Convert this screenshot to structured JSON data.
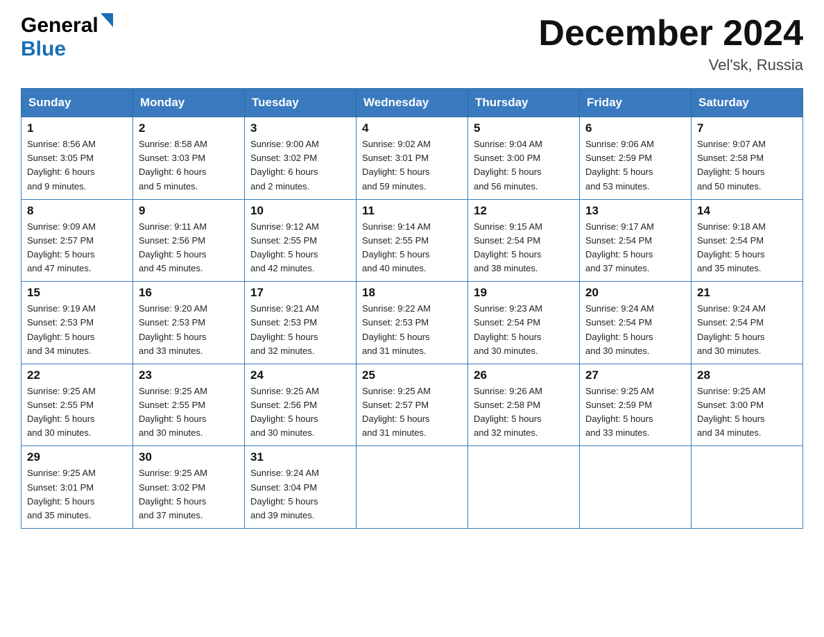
{
  "header": {
    "logo_general": "General",
    "logo_blue": "Blue",
    "month_title": "December 2024",
    "location": "Vel'sk, Russia"
  },
  "weekdays": [
    "Sunday",
    "Monday",
    "Tuesday",
    "Wednesday",
    "Thursday",
    "Friday",
    "Saturday"
  ],
  "weeks": [
    [
      {
        "day": "1",
        "sunrise": "8:56 AM",
        "sunset": "3:05 PM",
        "daylight": "6 hours and 9 minutes."
      },
      {
        "day": "2",
        "sunrise": "8:58 AM",
        "sunset": "3:03 PM",
        "daylight": "6 hours and 5 minutes."
      },
      {
        "day": "3",
        "sunrise": "9:00 AM",
        "sunset": "3:02 PM",
        "daylight": "6 hours and 2 minutes."
      },
      {
        "day": "4",
        "sunrise": "9:02 AM",
        "sunset": "3:01 PM",
        "daylight": "5 hours and 59 minutes."
      },
      {
        "day": "5",
        "sunrise": "9:04 AM",
        "sunset": "3:00 PM",
        "daylight": "5 hours and 56 minutes."
      },
      {
        "day": "6",
        "sunrise": "9:06 AM",
        "sunset": "2:59 PM",
        "daylight": "5 hours and 53 minutes."
      },
      {
        "day": "7",
        "sunrise": "9:07 AM",
        "sunset": "2:58 PM",
        "daylight": "5 hours and 50 minutes."
      }
    ],
    [
      {
        "day": "8",
        "sunrise": "9:09 AM",
        "sunset": "2:57 PM",
        "daylight": "5 hours and 47 minutes."
      },
      {
        "day": "9",
        "sunrise": "9:11 AM",
        "sunset": "2:56 PM",
        "daylight": "5 hours and 45 minutes."
      },
      {
        "day": "10",
        "sunrise": "9:12 AM",
        "sunset": "2:55 PM",
        "daylight": "5 hours and 42 minutes."
      },
      {
        "day": "11",
        "sunrise": "9:14 AM",
        "sunset": "2:55 PM",
        "daylight": "5 hours and 40 minutes."
      },
      {
        "day": "12",
        "sunrise": "9:15 AM",
        "sunset": "2:54 PM",
        "daylight": "5 hours and 38 minutes."
      },
      {
        "day": "13",
        "sunrise": "9:17 AM",
        "sunset": "2:54 PM",
        "daylight": "5 hours and 37 minutes."
      },
      {
        "day": "14",
        "sunrise": "9:18 AM",
        "sunset": "2:54 PM",
        "daylight": "5 hours and 35 minutes."
      }
    ],
    [
      {
        "day": "15",
        "sunrise": "9:19 AM",
        "sunset": "2:53 PM",
        "daylight": "5 hours and 34 minutes."
      },
      {
        "day": "16",
        "sunrise": "9:20 AM",
        "sunset": "2:53 PM",
        "daylight": "5 hours and 33 minutes."
      },
      {
        "day": "17",
        "sunrise": "9:21 AM",
        "sunset": "2:53 PM",
        "daylight": "5 hours and 32 minutes."
      },
      {
        "day": "18",
        "sunrise": "9:22 AM",
        "sunset": "2:53 PM",
        "daylight": "5 hours and 31 minutes."
      },
      {
        "day": "19",
        "sunrise": "9:23 AM",
        "sunset": "2:54 PM",
        "daylight": "5 hours and 30 minutes."
      },
      {
        "day": "20",
        "sunrise": "9:24 AM",
        "sunset": "2:54 PM",
        "daylight": "5 hours and 30 minutes."
      },
      {
        "day": "21",
        "sunrise": "9:24 AM",
        "sunset": "2:54 PM",
        "daylight": "5 hours and 30 minutes."
      }
    ],
    [
      {
        "day": "22",
        "sunrise": "9:25 AM",
        "sunset": "2:55 PM",
        "daylight": "5 hours and 30 minutes."
      },
      {
        "day": "23",
        "sunrise": "9:25 AM",
        "sunset": "2:55 PM",
        "daylight": "5 hours and 30 minutes."
      },
      {
        "day": "24",
        "sunrise": "9:25 AM",
        "sunset": "2:56 PM",
        "daylight": "5 hours and 30 minutes."
      },
      {
        "day": "25",
        "sunrise": "9:25 AM",
        "sunset": "2:57 PM",
        "daylight": "5 hours and 31 minutes."
      },
      {
        "day": "26",
        "sunrise": "9:26 AM",
        "sunset": "2:58 PM",
        "daylight": "5 hours and 32 minutes."
      },
      {
        "day": "27",
        "sunrise": "9:25 AM",
        "sunset": "2:59 PM",
        "daylight": "5 hours and 33 minutes."
      },
      {
        "day": "28",
        "sunrise": "9:25 AM",
        "sunset": "3:00 PM",
        "daylight": "5 hours and 34 minutes."
      }
    ],
    [
      {
        "day": "29",
        "sunrise": "9:25 AM",
        "sunset": "3:01 PM",
        "daylight": "5 hours and 35 minutes."
      },
      {
        "day": "30",
        "sunrise": "9:25 AM",
        "sunset": "3:02 PM",
        "daylight": "5 hours and 37 minutes."
      },
      {
        "day": "31",
        "sunrise": "9:24 AM",
        "sunset": "3:04 PM",
        "daylight": "5 hours and 39 minutes."
      },
      null,
      null,
      null,
      null
    ]
  ],
  "labels": {
    "sunrise": "Sunrise:",
    "sunset": "Sunset:",
    "daylight": "Daylight:"
  }
}
